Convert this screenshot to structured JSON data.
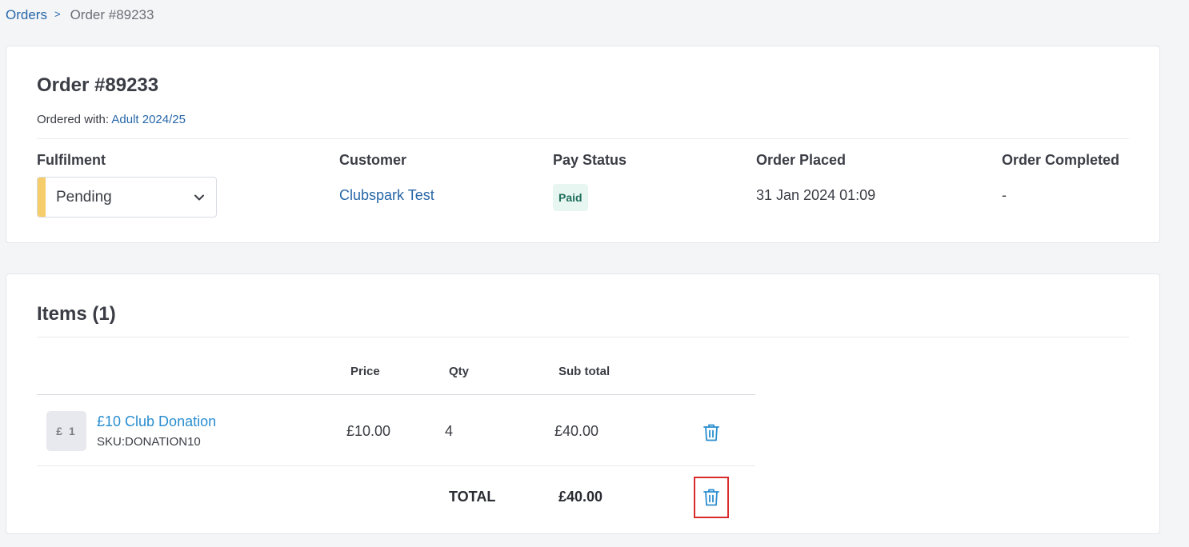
{
  "breadcrumb": {
    "parent": "Orders",
    "separator": ">",
    "current": "Order #89233"
  },
  "order": {
    "title": "Order #89233",
    "ordered_with_label": "Ordered with:",
    "ordered_with_value": "Adult 2024/25",
    "columns": {
      "fulfilment": "Fulfilment",
      "customer": "Customer",
      "pay_status": "Pay Status",
      "order_placed": "Order Placed",
      "order_completed": "Order Completed"
    },
    "fulfilment_value": "Pending",
    "customer_value": "Clubspark Test",
    "pay_status_value": "Paid",
    "order_placed_value": "31 Jan 2024 01:09",
    "order_completed_value": "-"
  },
  "items": {
    "title": "Items (1)",
    "headers": {
      "price": "Price",
      "qty": "Qty",
      "subtotal": "Sub total"
    },
    "rows": [
      {
        "thumb": "£ 1",
        "name": "£10 Club Donation",
        "sku": "SKU:DONATION10",
        "price": "£10.00",
        "qty": "4",
        "subtotal": "£40.00"
      }
    ],
    "total_label": "TOTAL",
    "total_value": "£40.00"
  },
  "colors": {
    "link": "#2767a8",
    "item_link": "#2a8ed0",
    "pending_bar": "#f6cd6b",
    "paid_badge_bg": "#e8f6f2",
    "paid_badge_text": "#1f6f5b",
    "highlight_border": "#d92b2b",
    "trash_icon": "#2a8ed0"
  },
  "icons": {
    "separator": "chevron-right-icon",
    "dropdown": "chevron-down-icon",
    "delete": "trash-icon"
  }
}
